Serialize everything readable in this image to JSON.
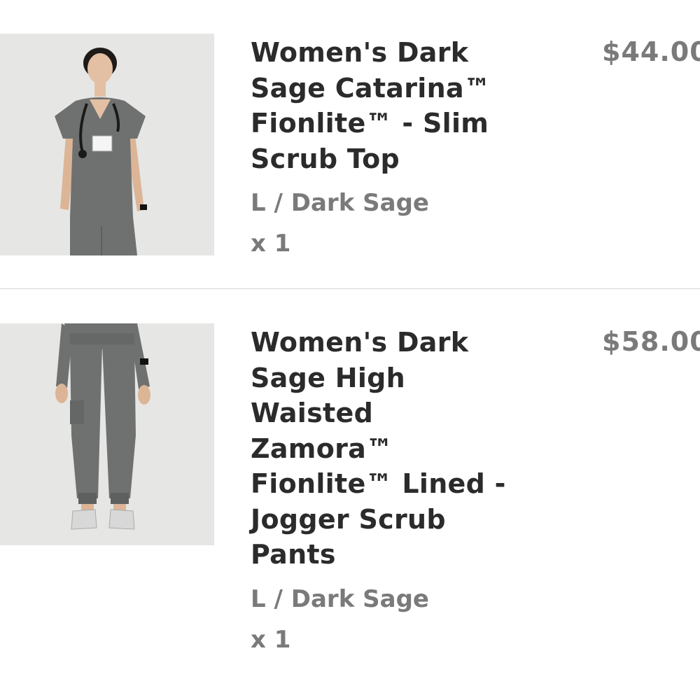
{
  "cart": {
    "items": [
      {
        "title": "Women's Dark\nSage Catarina™\nFionlite™ - Slim\nScrub Top",
        "variant": "L / Dark Sage",
        "quantity": "x 1",
        "price": "$44.00",
        "image_alt": "scrub-top-photo"
      },
      {
        "title": "Women's Dark\nSage High\nWaisted\nZamora™\nFionlite™ Lined -\nJogger Scrub\nPants",
        "variant": "L / Dark Sage",
        "quantity": "x 1",
        "price": "$58.00",
        "image_alt": "jogger-pants-photo"
      }
    ]
  },
  "colors": {
    "title": "#2b2b2b",
    "secondary": "#7a7a7a",
    "divider": "#d4d4d4",
    "thumb_bg": "#e6e6e4",
    "garment": "#6f7170"
  }
}
